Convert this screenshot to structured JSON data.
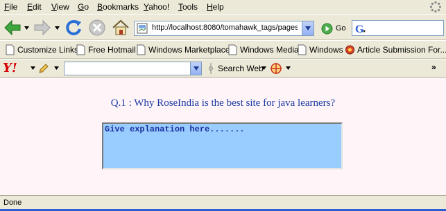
{
  "menu": {
    "file": "ile",
    "file_key": "F",
    "edit": "dit",
    "edit_key": "E",
    "view": "iew",
    "view_key": "V",
    "go": "o",
    "go_key": "G",
    "bookmarks": "ookmarks",
    "bookmarks_key": "B",
    "yahoo": "ahoo!",
    "yahoo_key": "Y",
    "tools": "ools",
    "tools_key": "T",
    "help": "elp",
    "help_key": "H"
  },
  "nav": {
    "url": "http://localhost:8080/tomahawk_tags/pages",
    "go_label": "Go"
  },
  "bookmarks": [
    {
      "label": "Customize Links"
    },
    {
      "label": "Free Hotmail"
    },
    {
      "label": "Windows Marketplace"
    },
    {
      "label": "Windows Media"
    },
    {
      "label": "Windows"
    },
    {
      "label": "Article Submission For..."
    }
  ],
  "yahoo_toolbar": {
    "logo": "Y!",
    "search_value": "",
    "search_web_label": "Search Web",
    "overflow": "»"
  },
  "page": {
    "question": "Q.1 : Why RoseIndia is the best site for java learners?",
    "answer_text": "Give explanation here......."
  },
  "status": {
    "text": "Done"
  },
  "colors": {
    "chrome_bg": "#ece9d8",
    "page_bg": "#fff5f8",
    "question_text": "#1a3aa6",
    "textarea_bg": "#99ccff",
    "textarea_text": "#1a2fa0"
  }
}
